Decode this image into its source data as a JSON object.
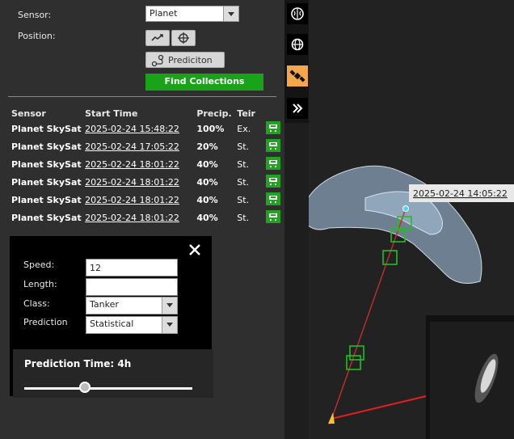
{
  "form": {
    "sensor_label": "Sensor:",
    "sensor_value": "Planet",
    "position_label": "Position:",
    "prediction_button": "Prediciton",
    "find_button": "Find Collections"
  },
  "table": {
    "headers": [
      "Sensor",
      "Start Time",
      "Precip.",
      "Teir"
    ],
    "rows": [
      {
        "sensor": "Planet SkySat",
        "time": "2025-02-24 15:48:22",
        "precip": "100%",
        "tier": "Ex."
      },
      {
        "sensor": "Planet SkySat",
        "time": "2025-02-24 17:05:22",
        "precip": "20%",
        "tier": "St."
      },
      {
        "sensor": "Planet SkySat",
        "time": "2025-02-24 18:01:22",
        "precip": "40%",
        "tier": "St."
      },
      {
        "sensor": "Planet SkySat",
        "time": "2025-02-24 18:01:22",
        "precip": "40%",
        "tier": "St."
      },
      {
        "sensor": "Planet SkySat",
        "time": "2025-02-24 18:01:22",
        "precip": "40%",
        "tier": "St."
      },
      {
        "sensor": "Planet SkySat",
        "time": "2025-02-24 18:01:22",
        "precip": "40%",
        "tier": "St."
      }
    ]
  },
  "ship": {
    "speed_label": "Speed:",
    "speed_value": "12",
    "length_label": "Length:",
    "length_value": "",
    "class_label": "Class:",
    "class_value": "Tanker",
    "prediction_label": "Prediction",
    "prediction_value": "Statistical",
    "prediction_time_label": "Prediction Time: 4h",
    "prediction_time_fraction": 0.36
  },
  "map": {
    "timestamp": "2025-02-24 14:05:22"
  },
  "toolbar": {
    "icons": [
      "brain-icon",
      "globe-icon",
      "satellite-icon",
      "chevrons-right-icon"
    ]
  }
}
